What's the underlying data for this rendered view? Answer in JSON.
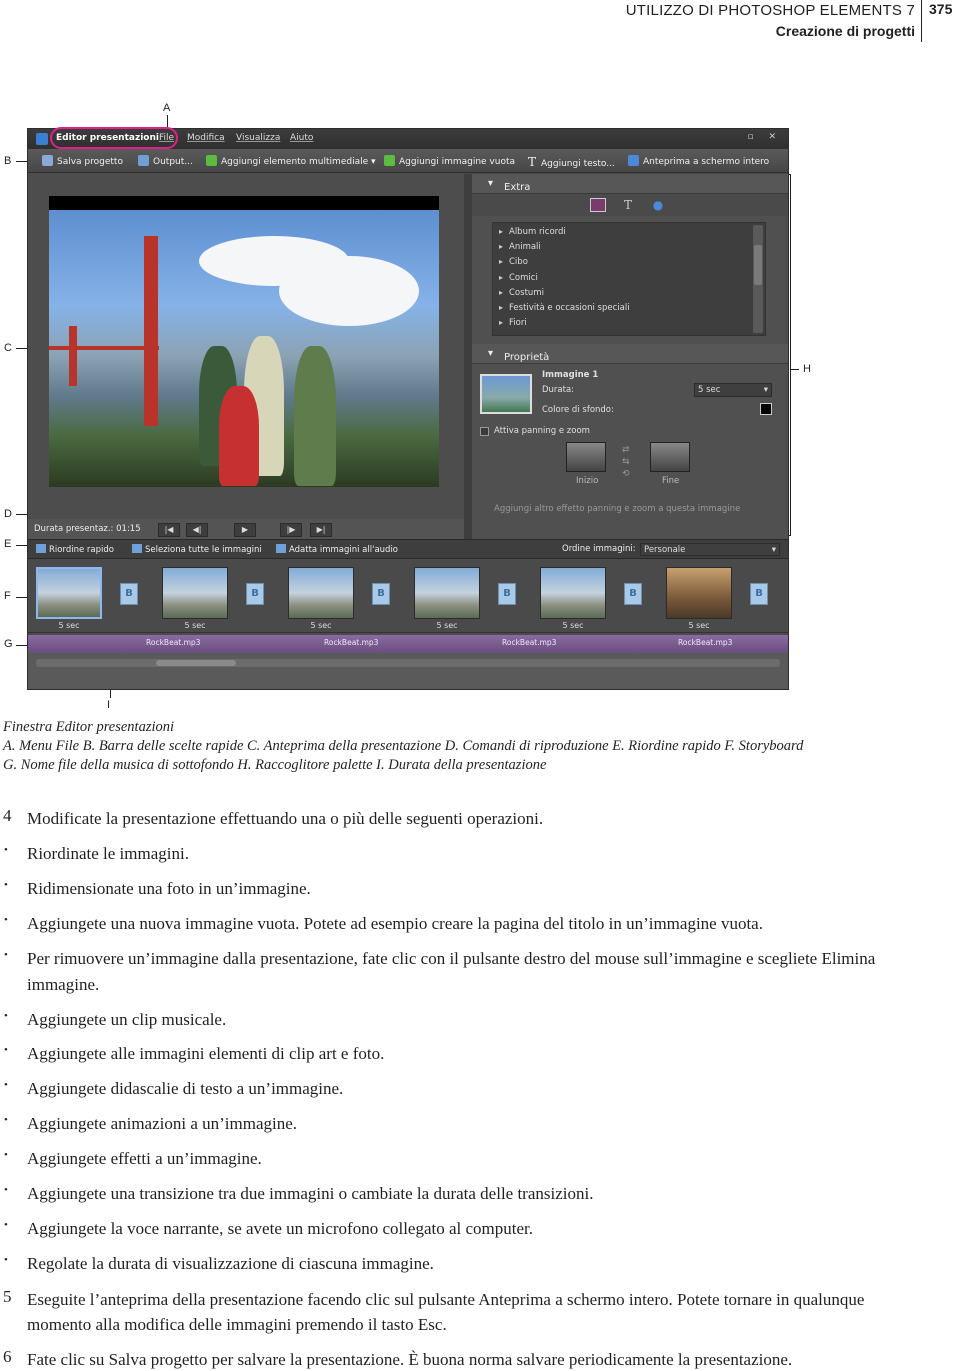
{
  "header": {
    "title": "UTILIZZO DI PHOTOSHOP ELEMENTS 7",
    "subtitle": "Creazione di progetti",
    "page_number": "375"
  },
  "callouts": {
    "A": "A",
    "B": "B",
    "C": "C",
    "D": "D",
    "E": "E",
    "F": "F",
    "G": "G",
    "H": "H",
    "I": "I"
  },
  "app": {
    "window_title": "Editor presentazioni",
    "menu": [
      "File",
      "Modifica",
      "Visualizza",
      "Aiuto"
    ],
    "window_buttons": "▫ ✕",
    "toolbar": {
      "save": "Salva progetto",
      "output": "Output...",
      "add_media": "Aggiungi elemento multimediale",
      "add_blank": "Aggiungi immagine vuota",
      "add_text": "Aggiungi testo...",
      "fullscreen": "Anteprima a schermo intero"
    },
    "extras": {
      "title": "Extra",
      "items": [
        "Album ricordi",
        "Animali",
        "Cibo",
        "Comici",
        "Costumi",
        "Festività e occasioni speciali",
        "Fiori"
      ]
    },
    "properties": {
      "title": "Proprietà",
      "image_name": "Immagine 1",
      "duration_label": "Durata:",
      "duration_value": "5 sec",
      "bg_color_label": "Colore di sfondo:",
      "pan_zoom_label": "Attiva panning e zoom",
      "start_label": "Inizio",
      "end_label": "Fine",
      "add_effect": "Aggiungi altro effetto panning e zoom a questa immagine"
    },
    "playback": {
      "duration": "Durata presentaz.: 01:15",
      "buttons": [
        "|◀",
        "◀|",
        "▶",
        "|▶",
        "▶|"
      ]
    },
    "quickbar": {
      "reorder": "Riordine rapido",
      "select_all": "Seleziona tutte le immagini",
      "fit_audio": "Adatta immagini all'audio",
      "order_label": "Ordine immagini:",
      "order_value": "Personale"
    },
    "storyboard": {
      "durations": [
        "5 sec",
        "5 sec",
        "5 sec",
        "5 sec",
        "5 sec",
        "5 sec"
      ],
      "transition_glyph": "B"
    },
    "music_files": [
      "RockBeat.mp3",
      "RockBeat.mp3",
      "RockBeat.mp3",
      "RockBeat.mp3"
    ]
  },
  "caption": {
    "title": "Finestra Editor presentazioni",
    "line1": "A. Menu File  B. Barra delle scelte rapide  C. Anteprima della presentazione  D. Comandi di riproduzione  E. Riordine rapido  F. Storyboard",
    "line2": "G. Nome file della musica di sottofondo  H. Raccoglitore palette  I. Durata della presentazione"
  },
  "step4": {
    "number": "4",
    "text": "Modificate la presentazione effettuando una o più delle seguenti operazioni."
  },
  "bullets": [
    "Riordinate le immagini.",
    "Ridimensionate una foto in un’immagine.",
    "Aggiungete una nuova immagine vuota. Potete ad esempio creare la pagina del titolo in un’immagine vuota.",
    "Per rimuovere un’immagine dalla presentazione, fate clic con il pulsante destro del mouse sull’immagine e scegliete Elimina immagine.",
    "Aggiungete un clip musicale.",
    "Aggiungete alle immagini elementi di clip art e foto.",
    "Aggiungete didascalie di testo a un’immagine.",
    "Aggiungete animazioni a un’immagine.",
    "Aggiungete effetti a un’immagine.",
    "Aggiungete una transizione tra due immagini o cambiate la durata delle transizioni.",
    "Aggiungete la voce narrante, se avete un microfono collegato al computer.",
    "Regolate la durata di visualizzazione di ciascuna immagine."
  ],
  "step5": {
    "number": "5",
    "text": "Eseguite l’anteprima della presentazione facendo clic sul pulsante Anteprima a schermo intero. Potete tornare in qualunque momento alla modifica delle immagini premendo il tasto Esc."
  },
  "step6": {
    "number": "6",
    "text": "Fate clic su Salva progetto per salvare la presentazione. È buona norma salvare periodicamente la presentazione."
  }
}
